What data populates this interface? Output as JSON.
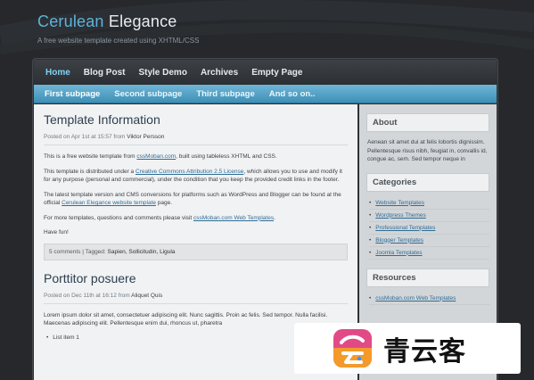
{
  "header": {
    "title_accent": "Cerulean",
    "title_rest": " Elegance",
    "tagline": "A free website template created using XHTML/CSS"
  },
  "main_nav": {
    "items": [
      {
        "label": "Home",
        "active": true
      },
      {
        "label": "Blog Post"
      },
      {
        "label": "Style Demo"
      },
      {
        "label": "Archives"
      },
      {
        "label": "Empty Page"
      }
    ]
  },
  "sub_nav": {
    "items": [
      {
        "label": "First subpage",
        "active": true
      },
      {
        "label": "Second subpage"
      },
      {
        "label": "Third subpage"
      },
      {
        "label": "And so on.."
      }
    ]
  },
  "posts": [
    {
      "title": "Template Information",
      "meta_prefix": "Posted on Apr 1st at 15:57 from ",
      "author": "Viktor Persson",
      "p1_a": "This is a free website template from ",
      "p1_link": "cssMoban.com",
      "p1_b": ", built using tableless XHTML and CSS.",
      "p2_a": "This template is distributed under a ",
      "p2_link": "Creative Commons Attribution 2.5 License",
      "p2_b": ", which allows you to use and modify it for any purpose (personal and commercial), under the condition that you keep the provided credit links in the footer.",
      "p3_a": "The latest template version and CMS conversions for platforms such as WordPress and Blogger can be found at the official ",
      "p3_link": "Cerulean Elegance website template",
      "p3_b": " page.",
      "p4_a": "For more templates, questions and comments please visit ",
      "p4_link": "cssMoban.com Web Templates",
      "p4_b": ".",
      "p5": "Have fun!",
      "footer_comments": "5 comments",
      "footer_sep": " | Tagged: ",
      "footer_tags": "Sapien, Sollicitudin, Ligula"
    },
    {
      "title": "Porttitor posuere",
      "meta_prefix": "Posted on Dec 11th at 16:12 from ",
      "author": "Aliquet Quis",
      "p1": "Lorem ipsum dolor sit amet, consectetuer adipiscing elit. Nunc sagittis. Proin ac felis. Sed tempor. Nulla facilisi. Maecenas adipiscing elit. Pellentesque enim dui, rhoncus ut, pharetra",
      "list": [
        "List item 1"
      ]
    }
  ],
  "sidebar": {
    "about": {
      "heading": "About",
      "text": "Aenean sit amet dui at felis lobortis dignissim. Pellentesque risus nibh, feugiat in, convallis id, congue ac, sem. Sed tempor neque in"
    },
    "categories": {
      "heading": "Categories",
      "items": [
        "Website Templates",
        "Wordpress Themes",
        "Professional Templates",
        "Blogger Templates",
        "Joomla Templates"
      ]
    },
    "resources": {
      "heading": "Resources",
      "items": [
        "cssMoban.com Web Templates"
      ]
    }
  },
  "watermark": {
    "text": "青云客"
  },
  "colors": {
    "accent_blue": "#5fb3d9",
    "subnav_blue": "#4b9dc3",
    "background": "#26282b",
    "content_bg": "#f1f2f3",
    "sidebar_bg": "#d3d6d9"
  }
}
